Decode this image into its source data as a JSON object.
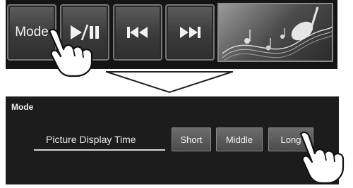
{
  "toolbar": {
    "mode_label": "Mode",
    "buttons": [
      {
        "name": "play-pause-icon"
      },
      {
        "name": "previous-track-icon"
      },
      {
        "name": "next-track-icon"
      }
    ],
    "thumbnail": {
      "name": "music-notes-thumbnail"
    }
  },
  "panel": {
    "title": "Mode",
    "setting_label": "Picture Display Time",
    "options": [
      "Short",
      "Middle",
      "Long"
    ]
  }
}
